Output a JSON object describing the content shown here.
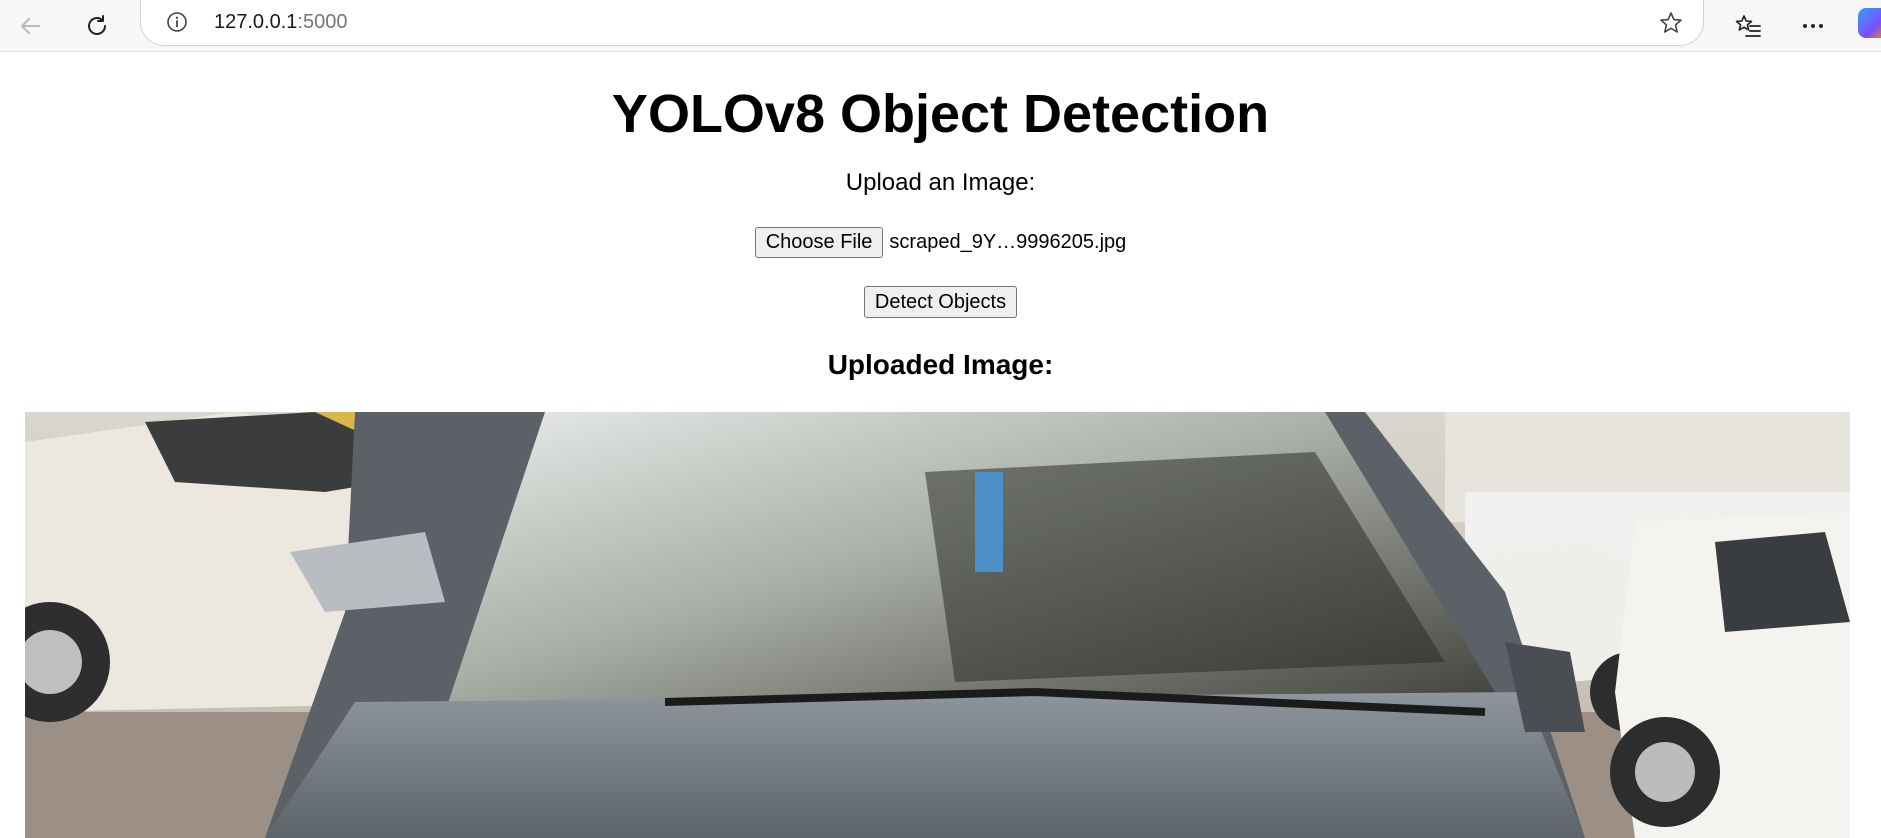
{
  "browser": {
    "url_host": "127.0.0.1",
    "url_port": ":5000",
    "icons": {
      "back": "back-arrow-icon",
      "reload": "reload-icon",
      "site_info": "info-icon",
      "favorite": "star-icon",
      "favorites": "favorites-list-icon",
      "more": "more-dots-icon"
    }
  },
  "page": {
    "title": "YOLOv8 Object Detection",
    "upload_label": "Upload an Image:",
    "choose_file_label": "Choose File",
    "file_name": "scraped_9Y…9996205.jpg",
    "detect_label": "Detect Objects",
    "uploaded_heading": "Uploaded Image:"
  },
  "colors": {
    "toolbar_bg": "#f7f7f7",
    "button_bg": "#efefef",
    "button_border": "#767676"
  }
}
